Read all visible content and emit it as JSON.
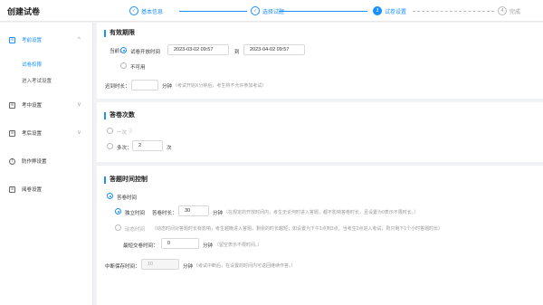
{
  "app": {
    "title": "创建试卷"
  },
  "steps": [
    {
      "num": "✓",
      "label": "基本信息",
      "state": "done"
    },
    {
      "num": "✓",
      "label": "选择试题",
      "state": "done"
    },
    {
      "num": "3",
      "label": "试卷设置",
      "state": "active"
    },
    {
      "num": "4",
      "label": "完成",
      "state": "todo"
    }
  ],
  "sidebar": {
    "groups": [
      {
        "label": "考前设置",
        "chevron": "^"
      },
      {
        "label": "考中设置",
        "chevron": "v"
      },
      {
        "label": "考后设置",
        "chevron": "v"
      },
      {
        "label": "防作弊设置",
        "chevron": ""
      },
      {
        "label": "阅卷设置",
        "chevron": ""
      }
    ],
    "subs": [
      "试卷权限",
      "进入考试设置"
    ]
  },
  "validity": {
    "title": "有效期限",
    "current_label": "当前：",
    "opt_time": "试卷开放时间",
    "start": "2023-03-02 09:57",
    "to": "到",
    "end": "2023-04-02 09:57",
    "opt_unavailable": "不可用",
    "late_label": "迟到时长：",
    "late_value": "",
    "late_unit": "分钟",
    "late_hint": "（考试开始X分钟后，考生将不允许参加考试）"
  },
  "attempts": {
    "title": "答卷次数",
    "once": "一次",
    "multi": "多次：",
    "multi_value": "2",
    "multi_unit": "次"
  },
  "timing": {
    "title": "答题时间控制",
    "answer_time": "答卷时间",
    "independent": "独立时间",
    "duration_label": "答卷时长：",
    "duration_value": "30",
    "duration_unit": "分钟",
    "independent_hint": "（在规定的开放时间内，考生无论何时进入答题，都不影响答卷时长，且设置为0表示不限时长。）",
    "dynamic": "动态时间",
    "dynamic_hint": "（动态时间对答题时长有影响，考生越晚进入答题，剩余的时长越短；如设置为下午1点到3点，当考生2点进入考试，则只剩下1个小时答题时长）",
    "min_submit_label": "最短交卷时间：",
    "min_submit_value": "0",
    "min_submit_unit": "分钟",
    "min_submit_hint": "（留空表示不限时间。）",
    "interrupt_label": "中断保存时间：",
    "interrupt_value": "10",
    "interrupt_unit": "分钟",
    "interrupt_hint": "（考试中断后，在设置的时间内可返回继续作答。）"
  },
  "colors": {
    "accent": "#1890ff"
  },
  "icons": {
    "first": "doc-icon",
    "second": "doc-icon",
    "third": "doc-icon",
    "fourth": "shield-icon",
    "fifth": "doc-icon"
  }
}
